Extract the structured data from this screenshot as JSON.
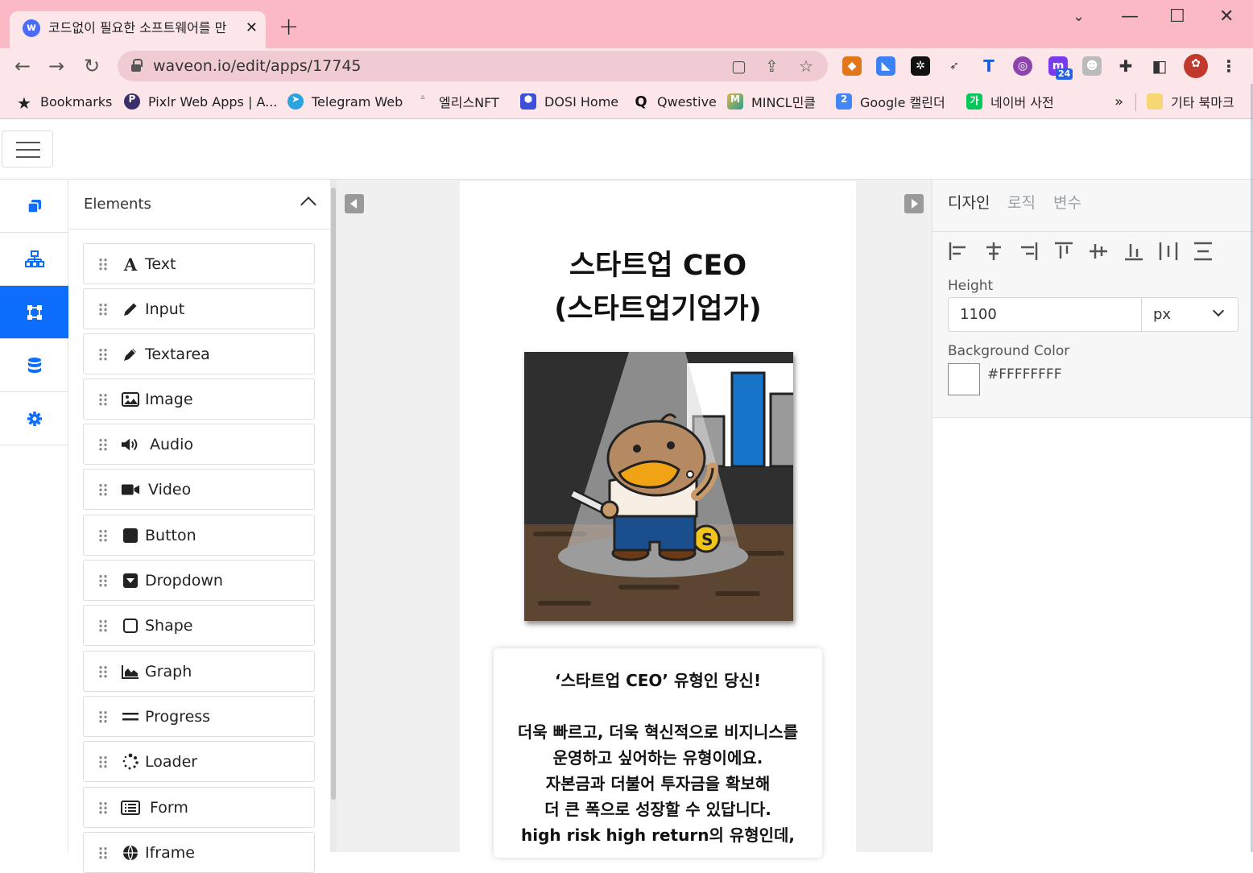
{
  "browser": {
    "tab_title": "코드없이 필요한 소프트웨어를 만",
    "tab_favicon": "w",
    "url": "waveon.io/edit/apps/17745",
    "extension_badge": "24",
    "bookmarks": [
      {
        "label": "Bookmarks",
        "icon": "star-icon",
        "color": "#202124"
      },
      {
        "label": "Pixlr Web Apps | A...",
        "icon": "pixlr-icon",
        "color": "#3b2f6b"
      },
      {
        "label": "Telegram Web",
        "icon": "telegram-icon",
        "color": "#2aa3df"
      },
      {
        "label": "엘리스NFT",
        "icon": "rabbit-icon",
        "color": "#cccccc"
      },
      {
        "label": "DOSI Home",
        "icon": "dosi-icon",
        "color": "#3b4fd8"
      },
      {
        "label": "Qwestive",
        "icon": "qwestive-icon",
        "color": "#111111"
      },
      {
        "label": "MINCL민클",
        "icon": "mincl-icon",
        "color": "#e0b84a"
      },
      {
        "label": "Google 캘린더",
        "icon": "calendar-icon",
        "color": "#4285f4"
      },
      {
        "label": "네이버 사전",
        "icon": "naver-icon",
        "color": "#03c75a"
      }
    ],
    "bookmarks_overflow": "»",
    "other_bookmarks": "기타 북마크"
  },
  "sidebar_rail": [
    {
      "icon": "copy-icon",
      "active": false
    },
    {
      "icon": "sitemap-icon",
      "active": false
    },
    {
      "icon": "vector-square-icon",
      "active": true
    },
    {
      "icon": "database-icon",
      "active": false
    },
    {
      "icon": "gear-icon",
      "active": false
    }
  ],
  "elements_panel": {
    "title": "Elements",
    "items": [
      {
        "label": "Text",
        "icon": "font-icon"
      },
      {
        "label": "Input",
        "icon": "pencil-icon"
      },
      {
        "label": "Textarea",
        "icon": "pen-icon"
      },
      {
        "label": "Image",
        "icon": "image-icon"
      },
      {
        "label": "Audio",
        "icon": "volume-icon"
      },
      {
        "label": "Video",
        "icon": "video-icon"
      },
      {
        "label": "Button",
        "icon": "square-filled-icon"
      },
      {
        "label": "Dropdown",
        "icon": "caret-square-down-icon"
      },
      {
        "label": "Shape",
        "icon": "square-outline-icon"
      },
      {
        "label": "Graph",
        "icon": "area-chart-icon"
      },
      {
        "label": "Progress",
        "icon": "equals-icon"
      },
      {
        "label": "Loader",
        "icon": "spinner-icon"
      },
      {
        "label": "Form",
        "icon": "list-alt-icon"
      },
      {
        "label": "Iframe",
        "icon": "globe-icon"
      }
    ]
  },
  "canvas": {
    "title_line1": "스타트업 CEO",
    "title_line2": "(스타트업기업가)",
    "illustration_alt": "duck-ceo-illustration",
    "card_lines": [
      "‘스타트업 CEO’ 유형인 당신!",
      "",
      "더욱 빠르고, 더욱 혁신적으로 비지니스를",
      "운영하고 싶어하는 유형이에요.",
      "자본금과 더불어 투자금을 확보해",
      "더 큰 폭으로 성장할 수 있답니다.",
      "high risk high return의 유형인데,"
    ]
  },
  "properties": {
    "tabs": [
      "디자인",
      "로직",
      "변수"
    ],
    "active_tab": 0,
    "align_tools": [
      "align-left-icon",
      "align-center-h-icon",
      "align-right-icon",
      "align-top-icon",
      "align-middle-v-icon",
      "align-bottom-icon",
      "distribute-h-icon",
      "distribute-v-icon"
    ],
    "height_label": "Height",
    "height_value": "1100",
    "height_unit": "px",
    "bg_label": "Background Color",
    "bg_value": "#FFFFFFFF"
  },
  "colors": {
    "accent": "#0d6efd",
    "titlebar": "#fbb8c5",
    "toolbar": "#fde6ea"
  }
}
